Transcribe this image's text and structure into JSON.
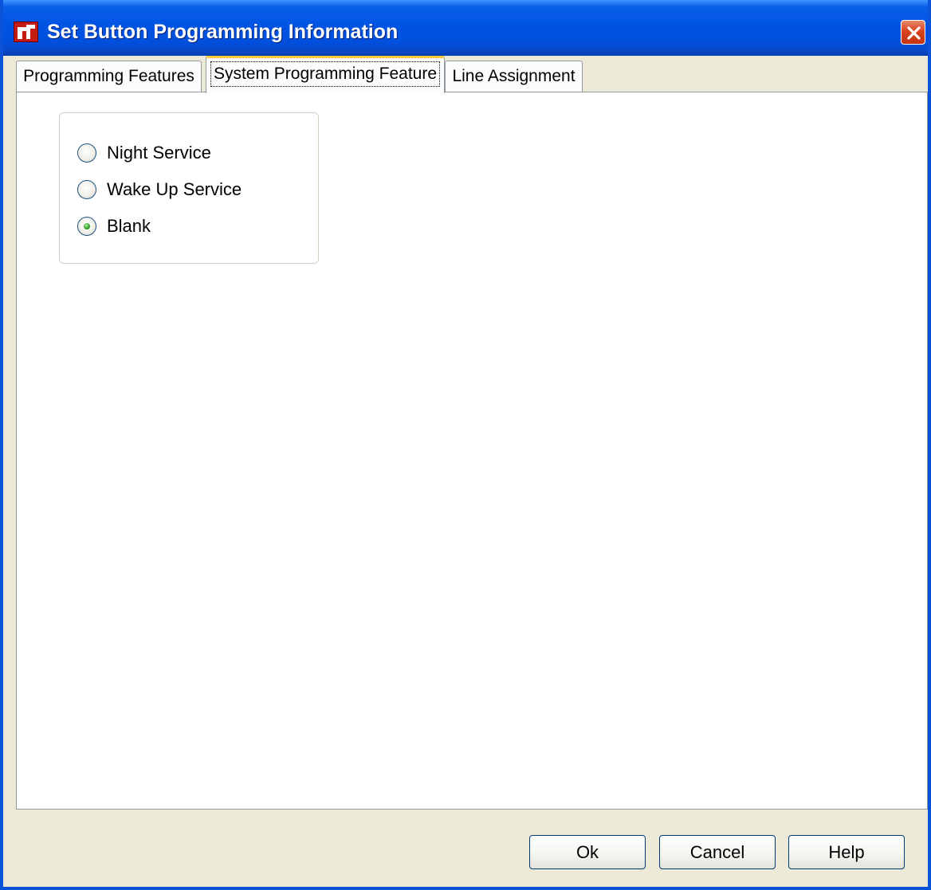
{
  "window": {
    "title": "Set Button Programming Information",
    "title_bar_color": "#0054e3",
    "close_button_color": "#d9441f"
  },
  "tabs": [
    {
      "label": "Programming Features",
      "active": false
    },
    {
      "label": "System Programming Feature",
      "active": true
    },
    {
      "label": "Line Assignment",
      "active": false
    }
  ],
  "options": {
    "items": [
      {
        "label": "Night Service",
        "selected": false
      },
      {
        "label": "Wake Up Service",
        "selected": false
      },
      {
        "label": "Blank",
        "selected": true
      }
    ]
  },
  "buttons": {
    "ok": "Ok",
    "cancel": "Cancel",
    "help": "Help"
  },
  "icons": {
    "app": "app-logo-icon",
    "close": "close-icon",
    "radio_selected": "radio-selected-icon"
  }
}
